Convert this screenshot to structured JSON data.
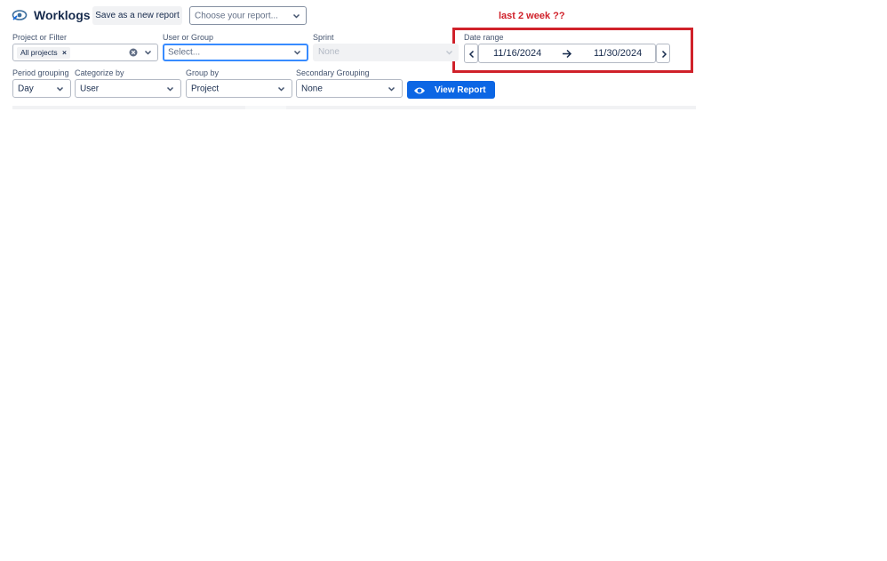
{
  "header": {
    "title": "Worklogs",
    "save_label": "Save as a new report",
    "report_select": {
      "placeholder": "Choose your report..."
    }
  },
  "filters": {
    "project": {
      "label": "Project or Filter",
      "tag": "All projects"
    },
    "user": {
      "label": "User or Group",
      "placeholder": "Select..."
    },
    "sprint": {
      "label": "Sprint",
      "value": "None"
    },
    "date_range": {
      "label": "Date range",
      "start": "11/16/2024",
      "end": "11/30/2024"
    }
  },
  "grouping": {
    "period": {
      "label": "Period grouping",
      "value": "Day"
    },
    "categorize": {
      "label": "Categorize by",
      "value": "User"
    },
    "group_by": {
      "label": "Group by",
      "value": "Project"
    },
    "secondary": {
      "label": "Secondary Grouping",
      "value": "None"
    },
    "view_label": "View Report"
  },
  "annotation": {
    "text": "last 2 week ??",
    "color": "#d0212a"
  },
  "colors": {
    "accent": "#0c66e4",
    "focus": "#388bff",
    "annotation_box": "#d0212a"
  },
  "icons": {
    "logo": "tracker-eye-logo-icon",
    "view": "eye-icon"
  }
}
